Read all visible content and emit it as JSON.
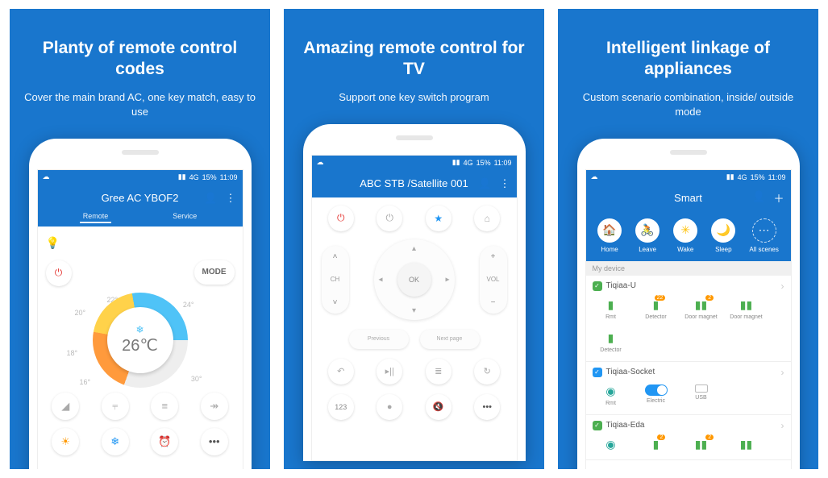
{
  "statusbar": {
    "signal": "4G",
    "battery": "15%",
    "time": "11:09"
  },
  "panel1": {
    "heading": "Planty of remote control codes",
    "sub": "Cover the main brand AC, one key match, easy to use",
    "appTitle": "Gree AC YBOF2",
    "tabs": {
      "remote": "Remote",
      "service": "Service"
    },
    "mode": "MODE",
    "temp": "26℃",
    "ticks": [
      "16°",
      "18°",
      "20°",
      "22°",
      "24°",
      "30°"
    ]
  },
  "panel2": {
    "heading": "Amazing remote control for TV",
    "sub": "Support one key switch program",
    "appTitle": "ABC STB /Satellite 001",
    "ch": "CH",
    "vol": "VOL",
    "ok": "OK",
    "prev": "Previous",
    "next": "Next page",
    "num": "123"
  },
  "panel3": {
    "heading": "Intelligent linkage of appliances",
    "sub": "Custom scenario combination, inside/ outside mode",
    "appTitle": "Smart",
    "scenes": {
      "home": "Home",
      "leave": "Leave",
      "wake": "Wake",
      "sleep": "Sleep",
      "all": "All scenes"
    },
    "myDevice": "My device",
    "dev1": {
      "name": "Tiqiaa-U",
      "rmt": "Rmt",
      "detector": "Detector",
      "door": "Door magnet",
      "badge": "22",
      "badge2": "2"
    },
    "dev2": {
      "name": "Tiqiaa-Socket",
      "rmt": "Rmt",
      "electric": "Electric",
      "usb": "USB"
    },
    "dev3": {
      "name": "Tiqiaa-Eda"
    }
  }
}
